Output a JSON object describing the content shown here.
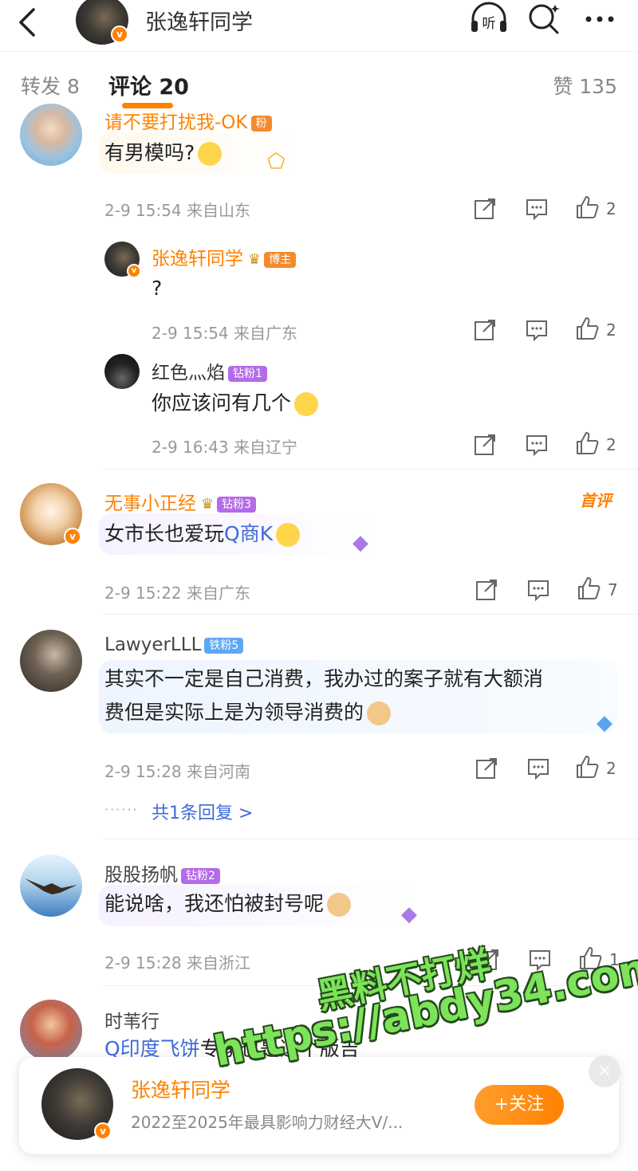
{
  "header": {
    "back_icon": "chevron-left-icon",
    "title": "张逸轩同学",
    "listen_label": "听"
  },
  "tabs": {
    "repost": "转发 8",
    "comment": "评论 20",
    "likes": "赞 135"
  },
  "comments": [
    {
      "name": "请不要打扰我-OK",
      "text": "有男模吗?",
      "meta": "2-9 15:54 来自山东",
      "likes": "2",
      "replies": [
        {
          "name": "张逸轩同学",
          "badge": "博主",
          "text": "?",
          "meta": "2-9 15:54 来自广东",
          "likes": "2"
        },
        {
          "name": "红色灬焰",
          "badge": "钻粉1",
          "text": "你应该问有几个",
          "meta": "2-9 16:43 来自辽宁",
          "likes": "2"
        }
      ]
    },
    {
      "name": "无事小正经",
      "badge": "钻粉3",
      "tag": "首评",
      "text_prefix": "女市长也爱玩",
      "search_text": "Q商K",
      "meta": "2-9 15:22 来自广东",
      "likes": "7"
    },
    {
      "name": "LawyerLLL",
      "badge": "铁粉5",
      "text_line1": "其实不一定是自己消费，我办过的案子就有大额消",
      "text_line2": "费但是实际上是为领导消费的",
      "meta": "2-9 15:28 来自河南",
      "likes": "2",
      "more_replies": "共1条回复 >"
    },
    {
      "name": "股股扬帆",
      "badge": "钻粉2",
      "text": "能说啥，我还怕被封号呢",
      "meta": "2-9 15:28 来自浙江",
      "likes": "1"
    },
    {
      "name": "时苇行",
      "search_text": "Q印度飞饼",
      "text_suffix": "专家也是这个版吉"
    }
  ],
  "follow_card": {
    "name": "张逸轩同学",
    "desc": "2022至2025年最具影响力财经大V/...",
    "button": "+关注",
    "close": "×"
  },
  "watermark": {
    "line1": "黑料不打烊",
    "line2": "https://abdy34.com"
  },
  "colors": {
    "accent": "#ff8200",
    "link": "#3f6ad8",
    "watermark": "#7de35a"
  }
}
